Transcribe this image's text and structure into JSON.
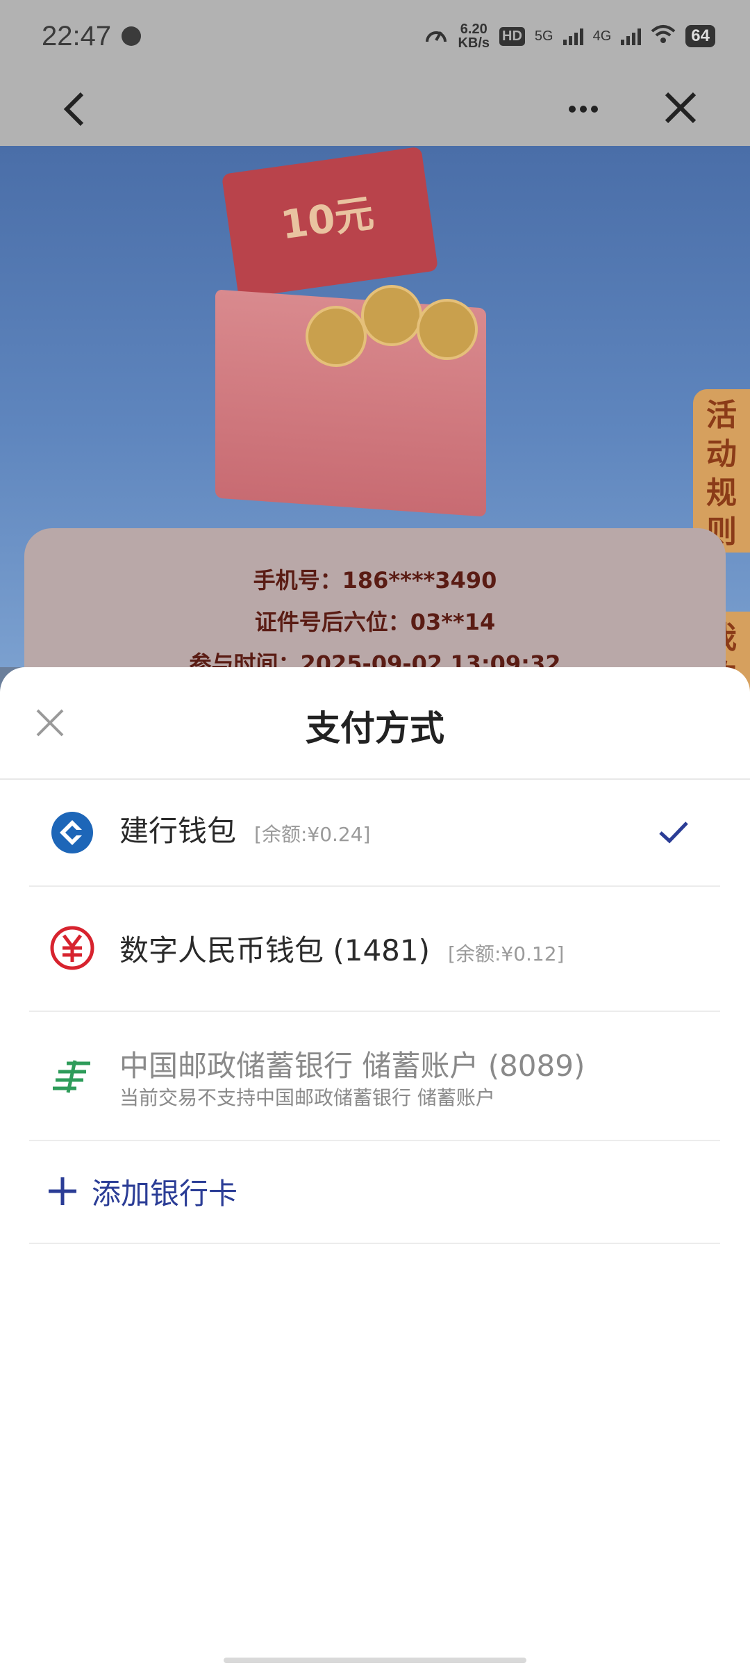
{
  "status_bar": {
    "time": "22:47",
    "speed_top": "6.20",
    "speed_unit": "KB/s",
    "hd_label": "HD",
    "sim1_label": "5G",
    "sim2_label": "4G",
    "battery": "64"
  },
  "info_card": {
    "phone": "手机号：186****3490",
    "id_last6": "证件号后六位：03**14",
    "join_time": "参与时间：2025-09-02 13:09:32"
  },
  "banner": {
    "envelope_text": "10元",
    "side_tab_rules": "活动规则",
    "side_tab_mine": "我的"
  },
  "sheet": {
    "title": "支付方式",
    "options": [
      {
        "name": "建行钱包",
        "balance": "[余额:¥0.24]",
        "icon": "ccb-wallet-icon",
        "selected": true
      },
      {
        "name": "数字人民币钱包 (1481)",
        "balance": "[余额:¥0.12]",
        "icon": "digital-rmb-icon",
        "selected": false
      },
      {
        "name": "中国邮政储蓄银行 储蓄账户 (8089)",
        "note": "当前交易不支持中国邮政储蓄银行 储蓄账户",
        "icon": "psbc-icon",
        "selected": false
      }
    ],
    "add_card": "添加银行卡"
  },
  "colors": {
    "accent_blue": "#2b3d96",
    "check_blue": "#2b3d96",
    "ccb_blue": "#1d66b8",
    "rmb_red": "#d7232e",
    "psbc_green": "#2e9c5a"
  }
}
